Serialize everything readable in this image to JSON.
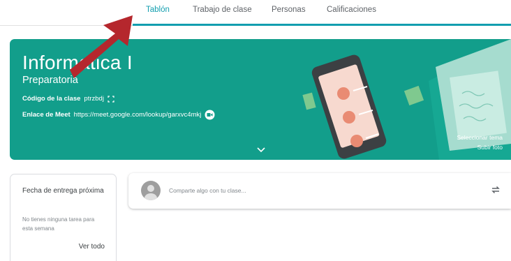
{
  "tabs": {
    "stream": "Tablón",
    "classwork": "Trabajo de clase",
    "people": "Personas",
    "grades": "Calificaciones"
  },
  "banner": {
    "title": "Informatica I",
    "subtitle": "Preparatoria",
    "class_code_label": "Código de la clase",
    "class_code_value": "ptrzbdj",
    "meet_label": "Enlace de Meet",
    "meet_url": "https://meet.google.com/lookup/garxvc4mkj",
    "select_theme": "Seleccionar tema",
    "upload_photo": "Subir foto"
  },
  "upcoming": {
    "heading": "Fecha de entrega próxima",
    "empty_text": "No tienes ninguna tarea para esta semana",
    "view_all": "Ver todo"
  },
  "share": {
    "placeholder": "Comparte algo con tu clase..."
  },
  "colors": {
    "accent": "#129eaf",
    "banner": "#129e8b",
    "annotation_arrow": "#b5272d"
  },
  "icons": {
    "class_code": "fullscreen-icon",
    "meet": "video-camera-icon",
    "expand": "chevron-down-icon",
    "repost": "repost-icon",
    "avatar": "avatar-icon"
  }
}
